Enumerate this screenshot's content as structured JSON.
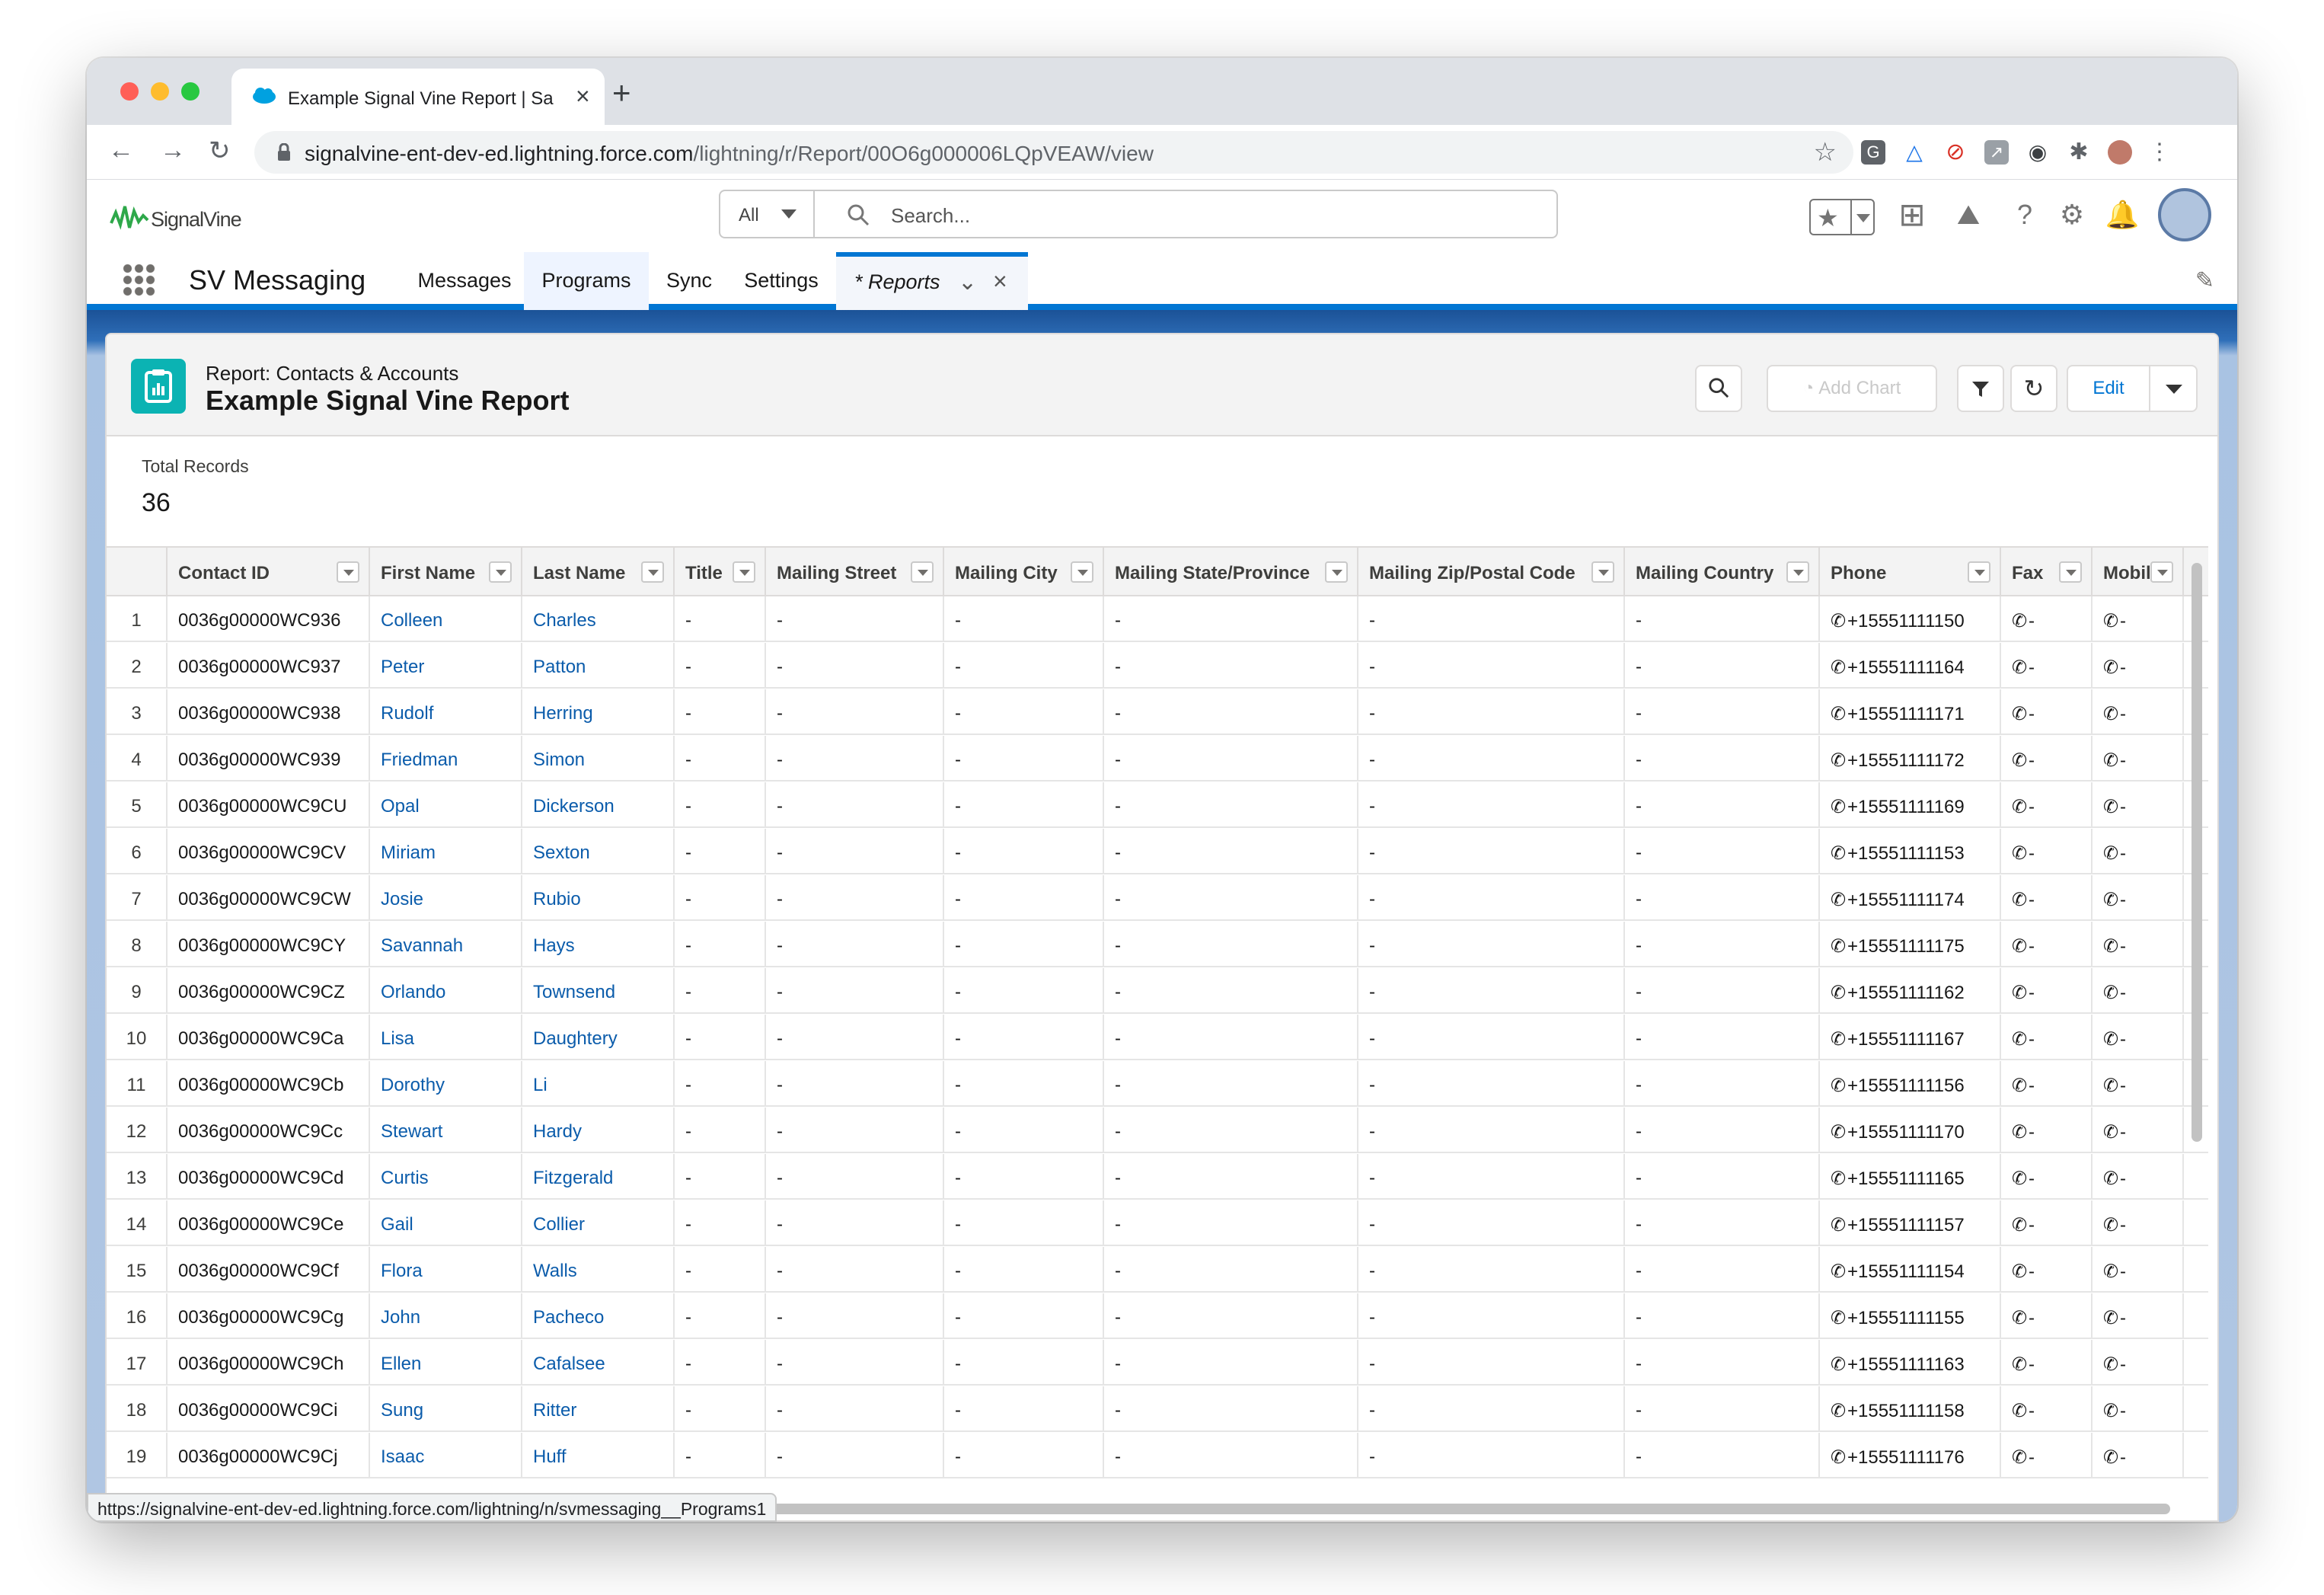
{
  "browser": {
    "tab_title": "Example Signal Vine Report | Sa",
    "url_host": "signalvine-ent-dev-ed.lightning.force.com",
    "url_path": "/lightning/r/Report/00O6g000006LQpVEAW/view"
  },
  "header": {
    "logo_text": "SignalVine",
    "search_scope": "All",
    "search_placeholder": "Search..."
  },
  "appnav": {
    "app_name": "SV Messaging",
    "items": [
      {
        "label": "Messages"
      },
      {
        "label": "Programs"
      },
      {
        "label": "Sync"
      },
      {
        "label": "Settings"
      },
      {
        "label": "* Reports"
      }
    ]
  },
  "report": {
    "type_label": "Report: Contacts & Accounts",
    "title": "Example Signal Vine Report",
    "add_chart_label": "Add Chart",
    "edit_label": "Edit",
    "total_records_label": "Total Records",
    "total_records": "36"
  },
  "columns": [
    "Contact ID",
    "First Name",
    "Last Name",
    "Title",
    "Mailing Street",
    "Mailing City",
    "Mailing State/Province",
    "Mailing Zip/Postal Code",
    "Mailing Country",
    "Phone",
    "Fax",
    "Mobile"
  ],
  "rows": [
    {
      "n": "1",
      "id": "0036g00000WC936",
      "first": "Colleen",
      "last": "Charles",
      "phone": "+15551111150"
    },
    {
      "n": "2",
      "id": "0036g00000WC937",
      "first": "Peter",
      "last": "Patton",
      "phone": "+15551111164"
    },
    {
      "n": "3",
      "id": "0036g00000WC938",
      "first": "Rudolf",
      "last": "Herring",
      "phone": "+15551111171"
    },
    {
      "n": "4",
      "id": "0036g00000WC939",
      "first": "Friedman",
      "last": "Simon",
      "phone": "+15551111172"
    },
    {
      "n": "5",
      "id": "0036g00000WC9CU",
      "first": "Opal",
      "last": "Dickerson",
      "phone": "+15551111169"
    },
    {
      "n": "6",
      "id": "0036g00000WC9CV",
      "first": "Miriam",
      "last": "Sexton",
      "phone": "+15551111153"
    },
    {
      "n": "7",
      "id": "0036g00000WC9CW",
      "first": "Josie",
      "last": "Rubio",
      "phone": "+15551111174"
    },
    {
      "n": "8",
      "id": "0036g00000WC9CY",
      "first": "Savannah",
      "last": "Hays",
      "phone": "+15551111175"
    },
    {
      "n": "9",
      "id": "0036g00000WC9CZ",
      "first": "Orlando",
      "last": "Townsend",
      "phone": "+15551111162"
    },
    {
      "n": "10",
      "id": "0036g00000WC9Ca",
      "first": "Lisa",
      "last": "Daughtery",
      "phone": "+15551111167"
    },
    {
      "n": "11",
      "id": "0036g00000WC9Cb",
      "first": "Dorothy",
      "last": "Li",
      "phone": "+15551111156"
    },
    {
      "n": "12",
      "id": "0036g00000WC9Cc",
      "first": "Stewart",
      "last": "Hardy",
      "phone": "+15551111170"
    },
    {
      "n": "13",
      "id": "0036g00000WC9Cd",
      "first": "Curtis",
      "last": "Fitzgerald",
      "phone": "+15551111165"
    },
    {
      "n": "14",
      "id": "0036g00000WC9Ce",
      "first": "Gail",
      "last": "Collier",
      "phone": "+15551111157"
    },
    {
      "n": "15",
      "id": "0036g00000WC9Cf",
      "first": "Flora",
      "last": "Walls",
      "phone": "+15551111154"
    },
    {
      "n": "16",
      "id": "0036g00000WC9Cg",
      "first": "John",
      "last": "Pacheco",
      "phone": "+15551111155"
    },
    {
      "n": "17",
      "id": "0036g00000WC9Ch",
      "first": "Ellen",
      "last": "Cafalsee",
      "phone": "+15551111163"
    },
    {
      "n": "18",
      "id": "0036g00000WC9Ci",
      "first": "Sung",
      "last": "Ritter",
      "phone": "+15551111158"
    },
    {
      "n": "19",
      "id": "0036g00000WC9Cj",
      "first": "Isaac",
      "last": "Huff",
      "phone": "+15551111176"
    }
  ],
  "empty_value": "-",
  "status_url": "https://signalvine-ent-dev-ed.lightning.force.com/lightning/n/svmessaging__Programs1",
  "colors": {
    "accent": "#0176d3",
    "link": "#0b5cab",
    "report_icon": "#0bb3b3"
  }
}
